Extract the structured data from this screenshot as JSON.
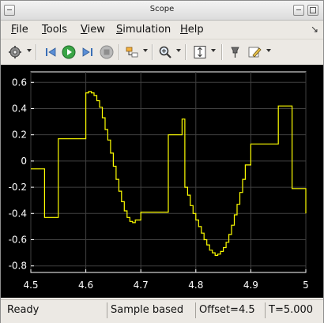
{
  "window": {
    "title": "Scope"
  },
  "menu": [
    {
      "label": "File",
      "u": "F",
      "rest": "ile"
    },
    {
      "label": "Tools",
      "u": "T",
      "rest": "ools"
    },
    {
      "label": "View",
      "u": "V",
      "rest": "iew"
    },
    {
      "label": "Simulation",
      "u": "S",
      "rest": "imulation"
    },
    {
      "label": "Help",
      "u": "H",
      "rest": "elp"
    }
  ],
  "toolbar": {
    "icons": [
      "gear-icon",
      "step-back-icon",
      "run-icon",
      "step-forward-icon",
      "stop-icon",
      "highlight-block-icon",
      "zoom-icon",
      "autoscale-icon",
      "pin-icon",
      "edit-icon"
    ]
  },
  "status": {
    "state": "Ready",
    "mode": "Sample based",
    "offset": "Offset=4.5",
    "time": "T=5.000"
  },
  "colors": {
    "plot_bg": "#000000",
    "axes_bg": "#000000",
    "grid": "#404040",
    "axis": "#ffffff",
    "signal": "#ffff00"
  },
  "chart_data": {
    "type": "line",
    "title": "",
    "xlabel": "",
    "ylabel": "",
    "xlim": [
      4.5,
      5.0
    ],
    "ylim": [
      -0.85,
      0.68
    ],
    "xticks": [
      "4.5",
      "4.6",
      "4.7",
      "4.8",
      "4.9",
      "5"
    ],
    "yticks": [
      "0.6",
      "0.4",
      "0.2",
      "0",
      "-0.2",
      "-0.4",
      "-0.6",
      "-0.8"
    ],
    "xtick_values": [
      4.5,
      4.6,
      4.7,
      4.8,
      4.9,
      5.0
    ],
    "ytick_values": [
      0.6,
      0.4,
      0.2,
      0,
      -0.2,
      -0.4,
      -0.6,
      -0.8
    ],
    "grid": true,
    "series": [
      {
        "step": true,
        "x": [
          4.5,
          4.525,
          4.55,
          4.575,
          4.6,
          4.605,
          4.61,
          4.615,
          4.62,
          4.625,
          4.63,
          4.635,
          4.64,
          4.645,
          4.65,
          4.655,
          4.66,
          4.665,
          4.67,
          4.675,
          4.68,
          4.685,
          4.69,
          4.7,
          4.75,
          4.775,
          4.78,
          4.785,
          4.79,
          4.795,
          4.8,
          4.805,
          4.81,
          4.815,
          4.82,
          4.825,
          4.83,
          4.835,
          4.84,
          4.845,
          4.85,
          4.855,
          4.86,
          4.865,
          4.87,
          4.875,
          4.88,
          4.885,
          4.89,
          4.9,
          4.925,
          4.95,
          4.975,
          5.0
        ],
        "y": [
          -0.06,
          -0.43,
          0.17,
          0.17,
          0.52,
          0.53,
          0.52,
          0.5,
          0.46,
          0.41,
          0.33,
          0.24,
          0.16,
          0.06,
          -0.04,
          -0.14,
          -0.23,
          -0.31,
          -0.38,
          -0.43,
          -0.46,
          -0.47,
          -0.45,
          -0.39,
          0.2,
          0.32,
          -0.2,
          -0.26,
          -0.34,
          -0.4,
          -0.45,
          -0.5,
          -0.55,
          -0.6,
          -0.64,
          -0.68,
          -0.7,
          -0.72,
          -0.71,
          -0.69,
          -0.66,
          -0.62,
          -0.56,
          -0.49,
          -0.41,
          -0.33,
          -0.24,
          -0.14,
          -0.03,
          0.13,
          0.13,
          0.42,
          -0.21,
          -0.4
        ]
      }
    ]
  }
}
